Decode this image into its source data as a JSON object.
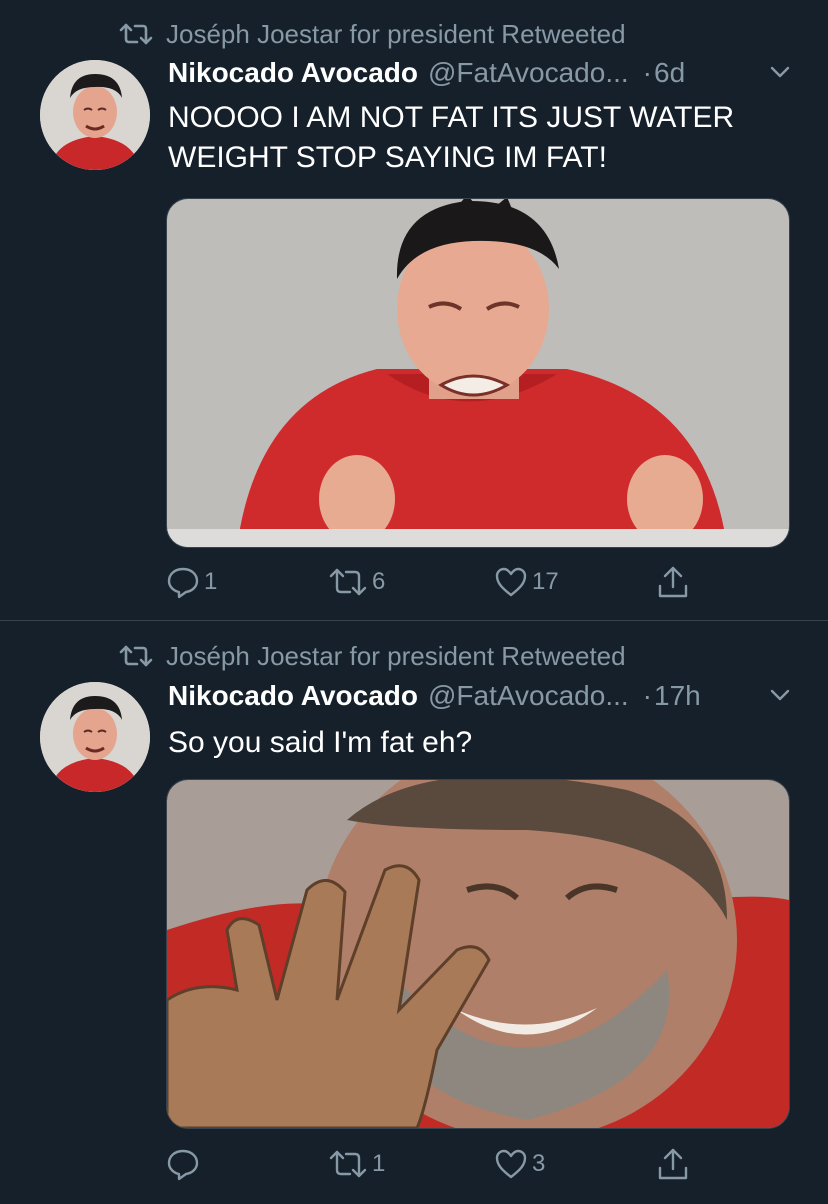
{
  "tweets": [
    {
      "retweeted_by": "Joséph Joestar for president Retweeted",
      "author_name": "Nikocado Avocado",
      "author_handle": "@FatAvocado...",
      "separator": "·",
      "time": "6d",
      "text_lines": [
        "NOOOO I AM NOT FAT ITS JUST WATER",
        "WEIGHT STOP SAYING IM FAT!"
      ],
      "replies": "1",
      "retweets": "6",
      "likes": "17"
    },
    {
      "retweeted_by": "Joséph Joestar for president Retweeted",
      "author_name": "Nikocado Avocado",
      "author_handle": "@FatAvocado...",
      "separator": "·",
      "time": "17h",
      "text_lines": [
        "So you said I'm fat eh?"
      ],
      "replies": "",
      "retweets": "1",
      "likes": "3"
    }
  ],
  "icons": [
    "retweet-icon",
    "chevron-down-icon",
    "reply-icon",
    "retweet-icon",
    "like-icon",
    "share-icon"
  ],
  "colors": {
    "background": "#15202b",
    "secondary_text": "#8899a6",
    "divider": "#38444d",
    "primary_text": "#ffffff"
  }
}
